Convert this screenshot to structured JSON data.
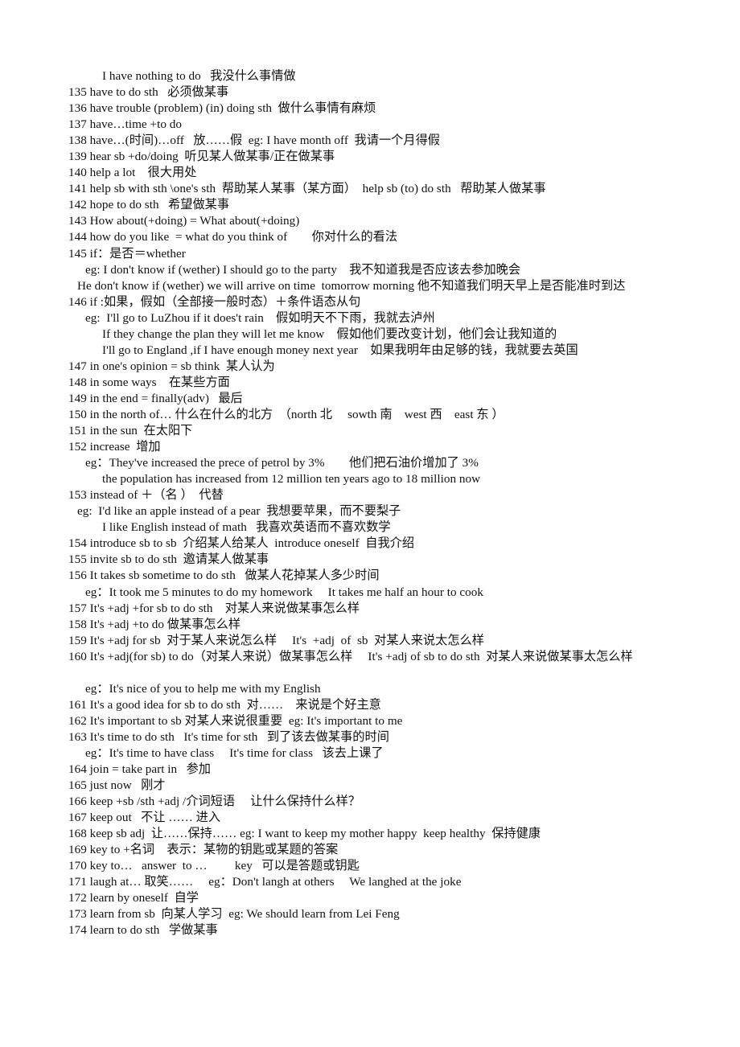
{
  "document": {
    "type": "english-chinese-phrase-reference",
    "page_range": "135-174",
    "lines": [
      {
        "indent": 4,
        "text": "I have nothing to do   我没什么事情做"
      },
      {
        "indent": 0,
        "text": "135 have to do sth   必须做某事"
      },
      {
        "indent": 0,
        "text": "136 have trouble (problem) (in) doing sth  做什么事情有麻烦"
      },
      {
        "indent": 0,
        "text": "137 have…time +to do"
      },
      {
        "indent": 0,
        "text": "138 have…(时间)…off   放……假  eg: I have month off  我请一个月得假"
      },
      {
        "indent": 0,
        "text": "139 hear sb +do/doing  听见某人做某事/正在做某事"
      },
      {
        "indent": 0,
        "text": "140 help a lot    很大用处"
      },
      {
        "indent": 0,
        "text": "141 help sb with sth \\one's sth  帮助某人某事（某方面）  help sb (to) do sth   帮助某人做某事"
      },
      {
        "indent": 0,
        "text": "142 hope to do sth   希望做某事"
      },
      {
        "indent": 0,
        "text": "143 How about(+doing) = What about(+doing)"
      },
      {
        "indent": 0,
        "text": "144 how do you like  = what do you think of　　你对什么的看法"
      },
      {
        "indent": 0,
        "text": "145 if：是否＝whether"
      },
      {
        "indent": 2,
        "text": "eg: I don't know if (wether) I should go to the party　我不知道我是否应该去参加晚会"
      },
      {
        "indent": 1,
        "text": "He don't know if (wether) we will arrive on time  tomorrow morning 他不知道我们明天早上是否能准时到达"
      },
      {
        "indent": 0,
        "text": "146 if :如果，假如（全部接一般时态）＋条件语态从句"
      },
      {
        "indent": 2,
        "text": "eg:  I'll go to LuZhou if it does't rain　假如明天不下雨，我就去泸州"
      },
      {
        "indent": 4,
        "text": "If they change the plan they will let me know　假如他们要改变计划，他们会让我知道的"
      },
      {
        "indent": 4,
        "text": "I'll go to England ,if I have enough money next year　如果我明年由足够的钱，我就要去英国"
      },
      {
        "indent": 0,
        "text": "147 in one's opinion = sb think  某人认为"
      },
      {
        "indent": 0,
        "text": "148 in some ways    在某些方面"
      },
      {
        "indent": 0,
        "text": "149 in the end = finally(adv)   最后"
      },
      {
        "indent": 0,
        "text": "150 in the north of… 什么在什么的北方　（north 北　 sowth 南　west 西　east 东 ）"
      },
      {
        "indent": 0,
        "text": "151 in the sun  在太阳下"
      },
      {
        "indent": 0,
        "text": "152 increase  增加"
      },
      {
        "indent": 2,
        "text": "eg：They've increased the prece of petrol by 3%　　他们把石油价增加了 3%"
      },
      {
        "indent": 4,
        "text": "the population has increased from 12 million ten years ago to 18 million now"
      },
      {
        "indent": 0,
        "text": "153 instead of ＋（名 ）  代替"
      },
      {
        "indent": 1,
        "text": "eg:  I'd like an apple instead of a pear  我想要苹果，而不要梨子"
      },
      {
        "indent": 4,
        "text": "I like English instead of math   我喜欢英语而不喜欢数学"
      },
      {
        "indent": 0,
        "text": "154 introduce sb to sb  介绍某人给某人  introduce oneself  自我介绍"
      },
      {
        "indent": 0,
        "text": "155 invite sb to do sth  邀请某人做某事"
      },
      {
        "indent": 0,
        "text": "156 It takes sb sometime to do sth   做某人花掉某人多少时间"
      },
      {
        "indent": 2,
        "text": "eg：It took me 5 minutes to do my homework　 It takes me half an hour to cook"
      },
      {
        "indent": 0,
        "text": "157 It's +adj +for sb to do sth    对某人来说做某事怎么样"
      },
      {
        "indent": 0,
        "text": "158 It's +adj +to do 做某事怎么样"
      },
      {
        "indent": 0,
        "text": "159 It's +adj for sb  对于某人来说怎么样　 It's  +adj  of  sb  对某人来说太怎么样"
      },
      {
        "indent": 0,
        "text": "160 It's +adj(for sb) to do（对某人来说）做某事怎么样　 It's +adj of sb to do sth  对某人来说做某事太怎么样"
      },
      {
        "indent": 0,
        "text": ""
      },
      {
        "indent": 2,
        "text": "eg：It's nice of you to help me with my English"
      },
      {
        "indent": 0,
        "text": "161 It's a good idea for sb to do sth  对……　来说是个好主意"
      },
      {
        "indent": 0,
        "text": "162 It's important to sb 对某人来说很重要  eg: It's important to me"
      },
      {
        "indent": 0,
        "text": "163 It's time to do sth   It's time for sth   到了该去做某事的时间"
      },
      {
        "indent": 2,
        "text": "eg：It's time to have class　 It's time for class   该去上课了"
      },
      {
        "indent": 0,
        "text": "164 join = take part in   参加"
      },
      {
        "indent": 0,
        "text": "165 just now   刚才"
      },
      {
        "indent": 0,
        "text": "166 keep +sb /sth +adj /介词短语　 让什么保持什么样？"
      },
      {
        "indent": 0,
        "text": "167 keep out   不让 …… 进入"
      },
      {
        "indent": 0,
        "text": "168 keep sb adj  让……保持…… eg: I want to keep my mother happy  keep healthy  保持健康"
      },
      {
        "indent": 0,
        "text": "169 key to +名词    表示：某物的钥匙或某题的答案"
      },
      {
        "indent": 0,
        "text": "170 key to…   answer  to …　　 key   可以是答题或钥匙"
      },
      {
        "indent": 0,
        "text": "171 laugh at… 取笑……　 eg：Don't langh at others　 We langhed at the joke"
      },
      {
        "indent": 0,
        "text": "172 learn by oneself  自学"
      },
      {
        "indent": 0,
        "text": "173 learn from sb  向某人学习  eg: We should learn from Lei Feng"
      },
      {
        "indent": 0,
        "text": "174 learn to do sth   学做某事"
      }
    ]
  }
}
